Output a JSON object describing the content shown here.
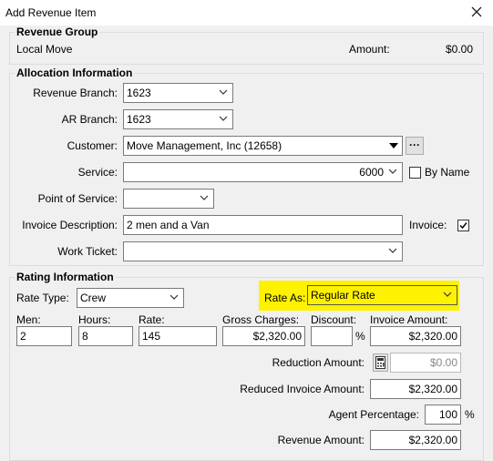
{
  "window": {
    "title": "Add Revenue Item"
  },
  "revenue_group": {
    "legend": "Revenue Group",
    "name": "Local Move",
    "amount_label": "Amount:",
    "amount_value": "$0.00"
  },
  "allocation": {
    "legend": "Allocation Information",
    "revenue_branch": {
      "label": "Revenue Branch:",
      "value": "1623"
    },
    "ar_branch": {
      "label": "AR Branch:",
      "value": "1623"
    },
    "customer": {
      "label": "Customer:",
      "value": "Move Management, Inc (12658)",
      "lookup": "···"
    },
    "service": {
      "label": "Service:",
      "value": "6000"
    },
    "by_name": {
      "label": "By Name",
      "checked": false
    },
    "point_of_service": {
      "label": "Point of Service:",
      "value": ""
    },
    "invoice_description": {
      "label": "Invoice Description:",
      "value": "2 men and a Van"
    },
    "invoice": {
      "label": "Invoice:",
      "checked": true
    },
    "work_ticket": {
      "label": "Work Ticket:",
      "value": ""
    }
  },
  "rating": {
    "legend": "Rating Information",
    "rate_type": {
      "label": "Rate Type:",
      "value": "Crew"
    },
    "rate_as": {
      "label": "Rate As:",
      "value": "Regular Rate"
    },
    "men": {
      "label": "Men:",
      "value": "2"
    },
    "hours": {
      "label": "Hours:",
      "value": "8"
    },
    "rate": {
      "label": "Rate:",
      "value": "145"
    },
    "gross_charges": {
      "label": "Gross Charges:",
      "value": "$2,320.00"
    },
    "discount": {
      "label": "Discount:",
      "value": "",
      "suffix": "%"
    },
    "invoice_amount": {
      "label": "Invoice Amount:",
      "value": "$2,320.00"
    },
    "reduction_amount": {
      "label": "Reduction Amount:",
      "value": "$0.00"
    },
    "reduced_invoice_amount": {
      "label": "Reduced Invoice Amount:",
      "value": "$2,320.00"
    },
    "agent_percentage": {
      "label": "Agent Percentage:",
      "value": "100",
      "suffix": "%"
    },
    "revenue_amount": {
      "label": "Revenue Amount:",
      "value": "$2,320.00"
    }
  },
  "colors": {
    "highlight": "#fff200",
    "window_bg": "#f0f0f0"
  }
}
